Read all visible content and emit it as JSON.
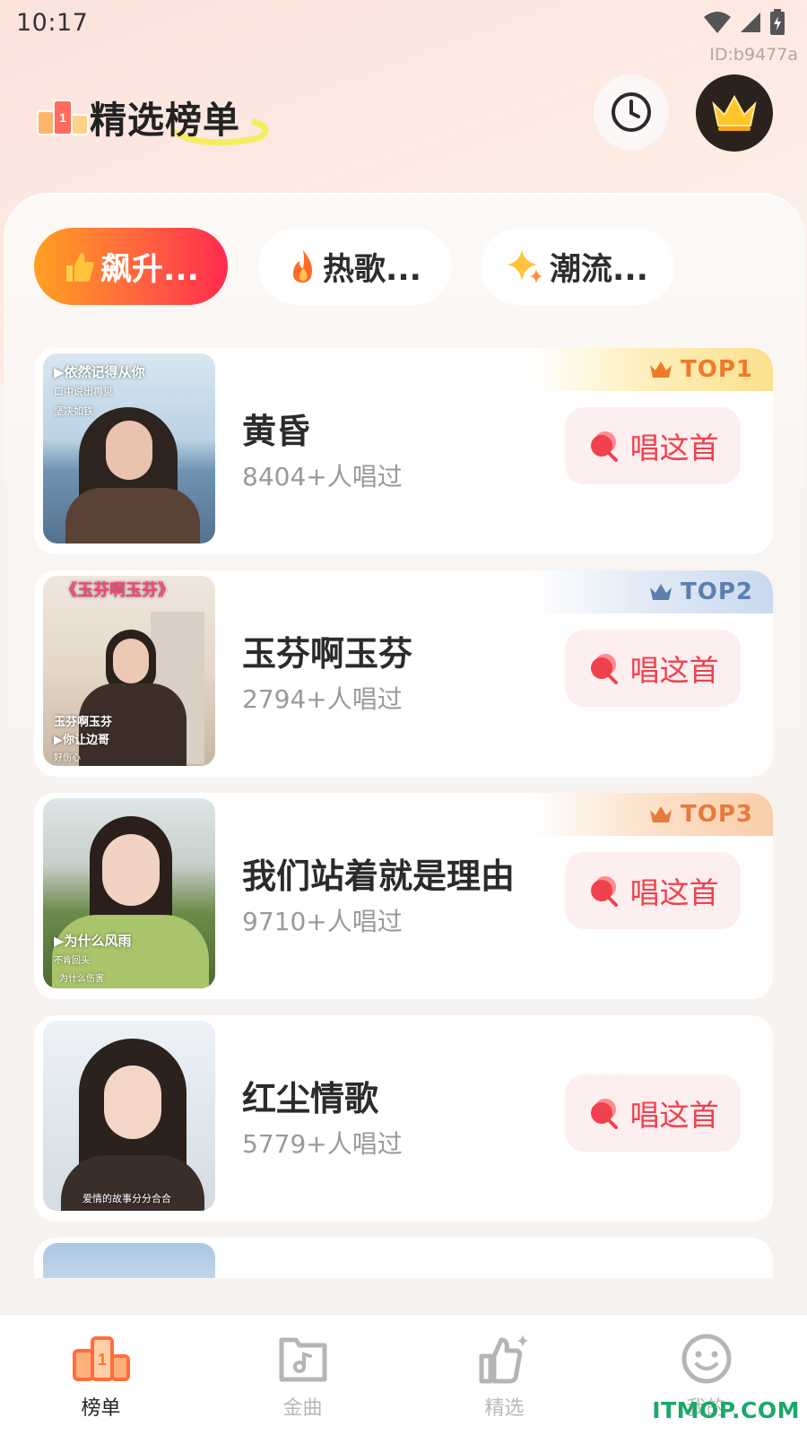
{
  "status_bar": {
    "time": "10:17"
  },
  "user_id": "ID:b9477a",
  "header": {
    "title": "精选榜单"
  },
  "tabs": [
    {
      "label": "飙升...",
      "icon": "thumbs-up-icon",
      "active": true
    },
    {
      "label": "热歌...",
      "icon": "fire-icon",
      "active": false
    },
    {
      "label": "潮流...",
      "icon": "sparkle-icon",
      "active": false
    }
  ],
  "songs": [
    {
      "title": "黄昏",
      "count": "8404+人唱过",
      "badge": "TOP1",
      "button": "唱这首",
      "caption1": "▶依然记得从你",
      "caption2": "口中说出再见",
      "caption3": "坚决如铁"
    },
    {
      "title": "玉芬啊玉芬",
      "count": "2794+人唱过",
      "badge": "TOP2",
      "button": "唱这首",
      "caption1": "《玉芬啊玉芬》",
      "caption2": "玉芬啊玉芬",
      "caption3": "▶你让边哥",
      "caption4": "好伤心"
    },
    {
      "title": "我们站着就是理由",
      "count": "9710+人唱过",
      "badge": "TOP3",
      "button": "唱这首",
      "caption1": "▶为什么风雨",
      "caption2": "不肯回头",
      "caption3": "为什么伤害"
    },
    {
      "title": "红尘情歌",
      "count": "5779+人唱过",
      "badge": "",
      "button": "唱这首",
      "caption1": "爱情的故事分分合合"
    }
  ],
  "nav": [
    {
      "label": "榜单",
      "icon": "ranking-icon",
      "active": true
    },
    {
      "label": "金曲",
      "icon": "music-note-icon",
      "active": false
    },
    {
      "label": "精选",
      "icon": "thumbs-up-sparkle-icon",
      "active": false
    },
    {
      "label": "我的",
      "icon": "smiley-icon",
      "active": false
    }
  ],
  "watermark": "ITMOP.COM",
  "colors": {
    "accent": "#ff2b4e",
    "button_text": "#f0414e",
    "button_bg": "#fdeeef",
    "orange": "#ffa022"
  }
}
